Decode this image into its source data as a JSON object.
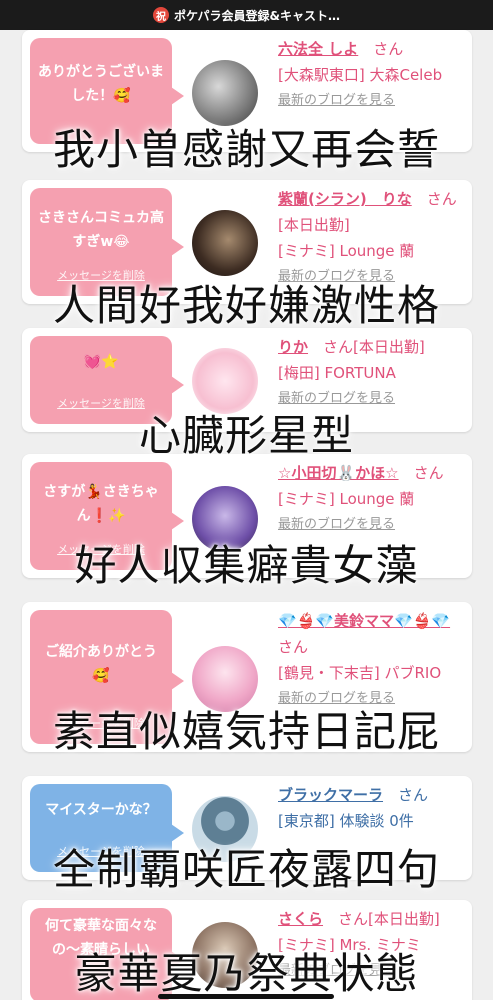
{
  "header": {
    "badge": "祝",
    "title": "ポケパラ会員登録&キャスト…"
  },
  "cards": [
    {
      "bubble_color": "pink",
      "message": "ありがとうございました！🥰",
      "delete_label": "",
      "name": "六法全 しよ",
      "honorific": "さん",
      "location": "[大森駅東口] 大森Celeb",
      "blog_link": "最新のブログを見る"
    },
    {
      "bubble_color": "pink",
      "message": "さきさんコミュカ高すぎw😂",
      "delete_label": "メッセージを削除",
      "name": "紫蘭(シラン)　りな",
      "honorific": "さん[本日出勤]",
      "location": "[ミナミ] Lounge 蘭",
      "blog_link": "最新のブログを見る"
    },
    {
      "bubble_color": "pink",
      "message": "💓⭐",
      "delete_label": "メッセージを削除",
      "name": "りか",
      "honorific": "さん[本日出勤]",
      "location": "[梅田] FORTUNA",
      "blog_link": "最新のブログを見る"
    },
    {
      "bubble_color": "pink",
      "message": "さすが💃さきちゃん❗✨",
      "delete_label": "メッセージを削除",
      "name": "☆小田切🐰かほ☆",
      "honorific": "さん",
      "location": "[ミナミ] Lounge 蘭",
      "blog_link": "最新のブログを見る"
    },
    {
      "bubble_color": "pink",
      "message": "ご紹介ありがとう🥰",
      "delete_label": "メッセージを削除",
      "name": "💎👙💎美鈴ママ💎👙💎",
      "honorific": "さん",
      "location": "[鶴見・下末吉] パブRIO",
      "blog_link": "最新のブログを見る"
    },
    {
      "bubble_color": "blue",
      "message": "マイスターかな？",
      "delete_label": "メッセージを削除",
      "name": "ブラックマーラ",
      "honorific": "さん",
      "location": "[東京都] 体験談 0件",
      "blog_link": ""
    },
    {
      "bubble_color": "pink",
      "message": "何て豪華な面々なの〜素晴らしい",
      "delete_label": "",
      "name": "さくら",
      "honorific": "さん[本日出勤]",
      "location": "[ミナミ] Mrs. ミナミ",
      "blog_link": "最新のブログを見る"
    }
  ],
  "overlays": [
    "我小曽感謝又再会誓",
    "人間好我好嫌激性格",
    "心臓形星型",
    "好人収集癖貴女藻",
    "素直似嬉気持日記屁",
    "全制覇咲匠夜露四句",
    "豪華夏乃祭典状態"
  ]
}
